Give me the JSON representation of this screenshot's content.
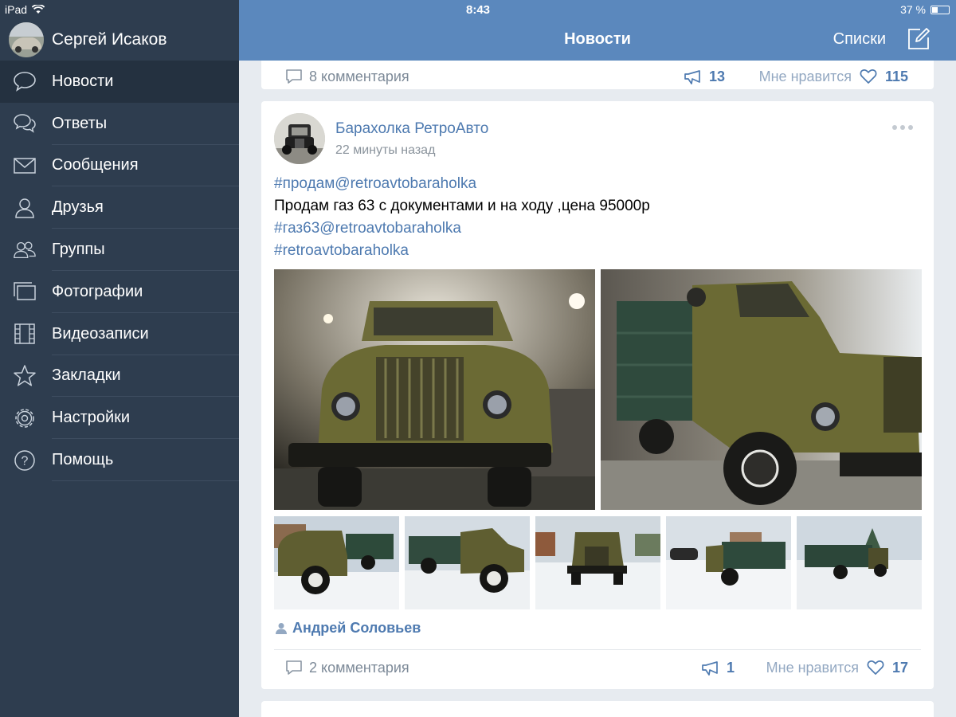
{
  "status_bar": {
    "device": "iPad",
    "time": "8:43",
    "battery": "37 %"
  },
  "sidebar": {
    "profile_name": "Сергей Исаков",
    "items": [
      {
        "label": "Новости",
        "icon": "bubble-icon",
        "active": true
      },
      {
        "label": "Ответы",
        "icon": "bubbles-icon"
      },
      {
        "label": "Сообщения",
        "icon": "envelope-icon"
      },
      {
        "label": "Друзья",
        "icon": "person-icon"
      },
      {
        "label": "Группы",
        "icon": "people-icon"
      },
      {
        "label": "Фотографии",
        "icon": "photos-icon"
      },
      {
        "label": "Видеозаписи",
        "icon": "film-icon"
      },
      {
        "label": "Закладки",
        "icon": "star-icon"
      },
      {
        "label": "Настройки",
        "icon": "gear-icon"
      },
      {
        "label": "Помощь",
        "icon": "question-icon"
      }
    ]
  },
  "topbar": {
    "title": "Новости",
    "lists_label": "Списки"
  },
  "previous_post": {
    "comments": "8 комментария",
    "reposts": "13",
    "like_label": "Мне нравится",
    "likes": "115"
  },
  "post": {
    "group_name": "Барахолка РетроАвто",
    "time": "22 минуты назад",
    "lines": [
      {
        "text": "#продам@retroavtobaraholka",
        "kind": "tag"
      },
      {
        "text": "Продам газ 63 с документами и на ходу ,цена 95000р",
        "kind": "body"
      },
      {
        "text": "#газ63@retroavtobaraholka",
        "kind": "tag"
      },
      {
        "text": "#retroavtobaraholka",
        "kind": "tag"
      }
    ],
    "author": "Андрей Соловьев",
    "comments": "2 комментария",
    "reposts": "1",
    "like_label": "Мне нравится",
    "likes": "17"
  },
  "colors": {
    "sidebar": "#2e3d4f",
    "topbar": "#5b88bd",
    "link": "#4e7ab0",
    "truck": "#6b6a34"
  }
}
